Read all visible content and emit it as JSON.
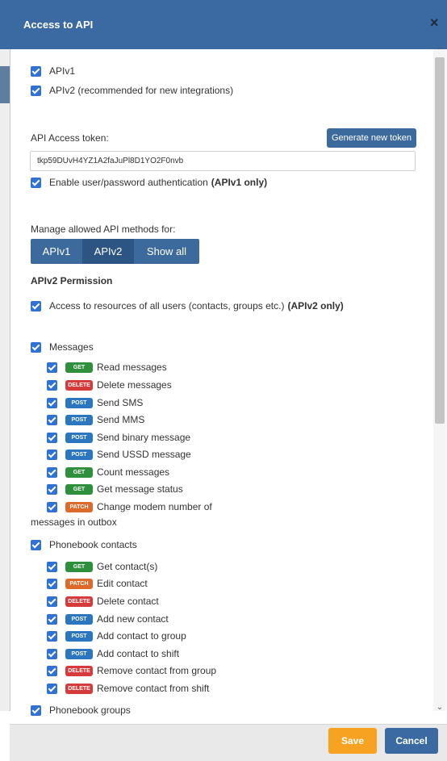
{
  "dialog": {
    "title": "Access to API",
    "close_icon": "×"
  },
  "api_versions": {
    "apiv1_label": "APIv1",
    "apiv2_label": "APIv2 (recommended for new integrations)"
  },
  "token": {
    "label": "API Access token:",
    "generate_button": "Generate new token",
    "value": "tkp59DUvH4YZ1A2faJuPl8D1YO2F0nvb"
  },
  "auth": {
    "label": "Enable user/password authentication",
    "label_bold": "(APIv1 only)"
  },
  "manage": {
    "label": "Manage allowed API methods for:",
    "tabs": [
      {
        "label": "APIv1"
      },
      {
        "label": "APIv2"
      },
      {
        "label": "Show all"
      }
    ]
  },
  "permission": {
    "heading": "APIv2 Permission",
    "all_users_label": "Access to resources of all users (contacts, groups etc.)",
    "all_users_bold": "(APIv2 only)"
  },
  "messages": {
    "heading": "Messages",
    "items": [
      {
        "method": "GET",
        "label": "Read messages"
      },
      {
        "method": "DELETE",
        "label": "Delete messages"
      },
      {
        "method": "POST",
        "label": "Send SMS"
      },
      {
        "method": "POST",
        "label": "Send MMS"
      },
      {
        "method": "POST",
        "label": "Send binary message"
      },
      {
        "method": "POST",
        "label": "Send USSD message"
      },
      {
        "method": "GET",
        "label": "Count messages"
      },
      {
        "method": "GET",
        "label": "Get message status"
      },
      {
        "method": "PATCH",
        "label": "Change modem number of",
        "label_cont": "messages in outbox"
      }
    ]
  },
  "contacts": {
    "heading": "Phonebook contacts",
    "items": [
      {
        "method": "GET",
        "label": "Get contact(s)"
      },
      {
        "method": "PATCH",
        "label": "Edit contact"
      },
      {
        "method": "DELETE",
        "label": "Delete contact"
      },
      {
        "method": "POST",
        "label": "Add new contact"
      },
      {
        "method": "POST",
        "label": "Add contact to group"
      },
      {
        "method": "POST",
        "label": "Add contact to shift"
      },
      {
        "method": "DELETE",
        "label": "Remove contact from group"
      },
      {
        "method": "DELETE",
        "label": "Remove contact from shift"
      }
    ]
  },
  "groups": {
    "heading": "Phonebook groups"
  },
  "footer": {
    "save_label": "Save",
    "cancel_label": "Cancel"
  },
  "scrollbar": {
    "up_icon": "⌃",
    "down_icon": "⌄"
  }
}
